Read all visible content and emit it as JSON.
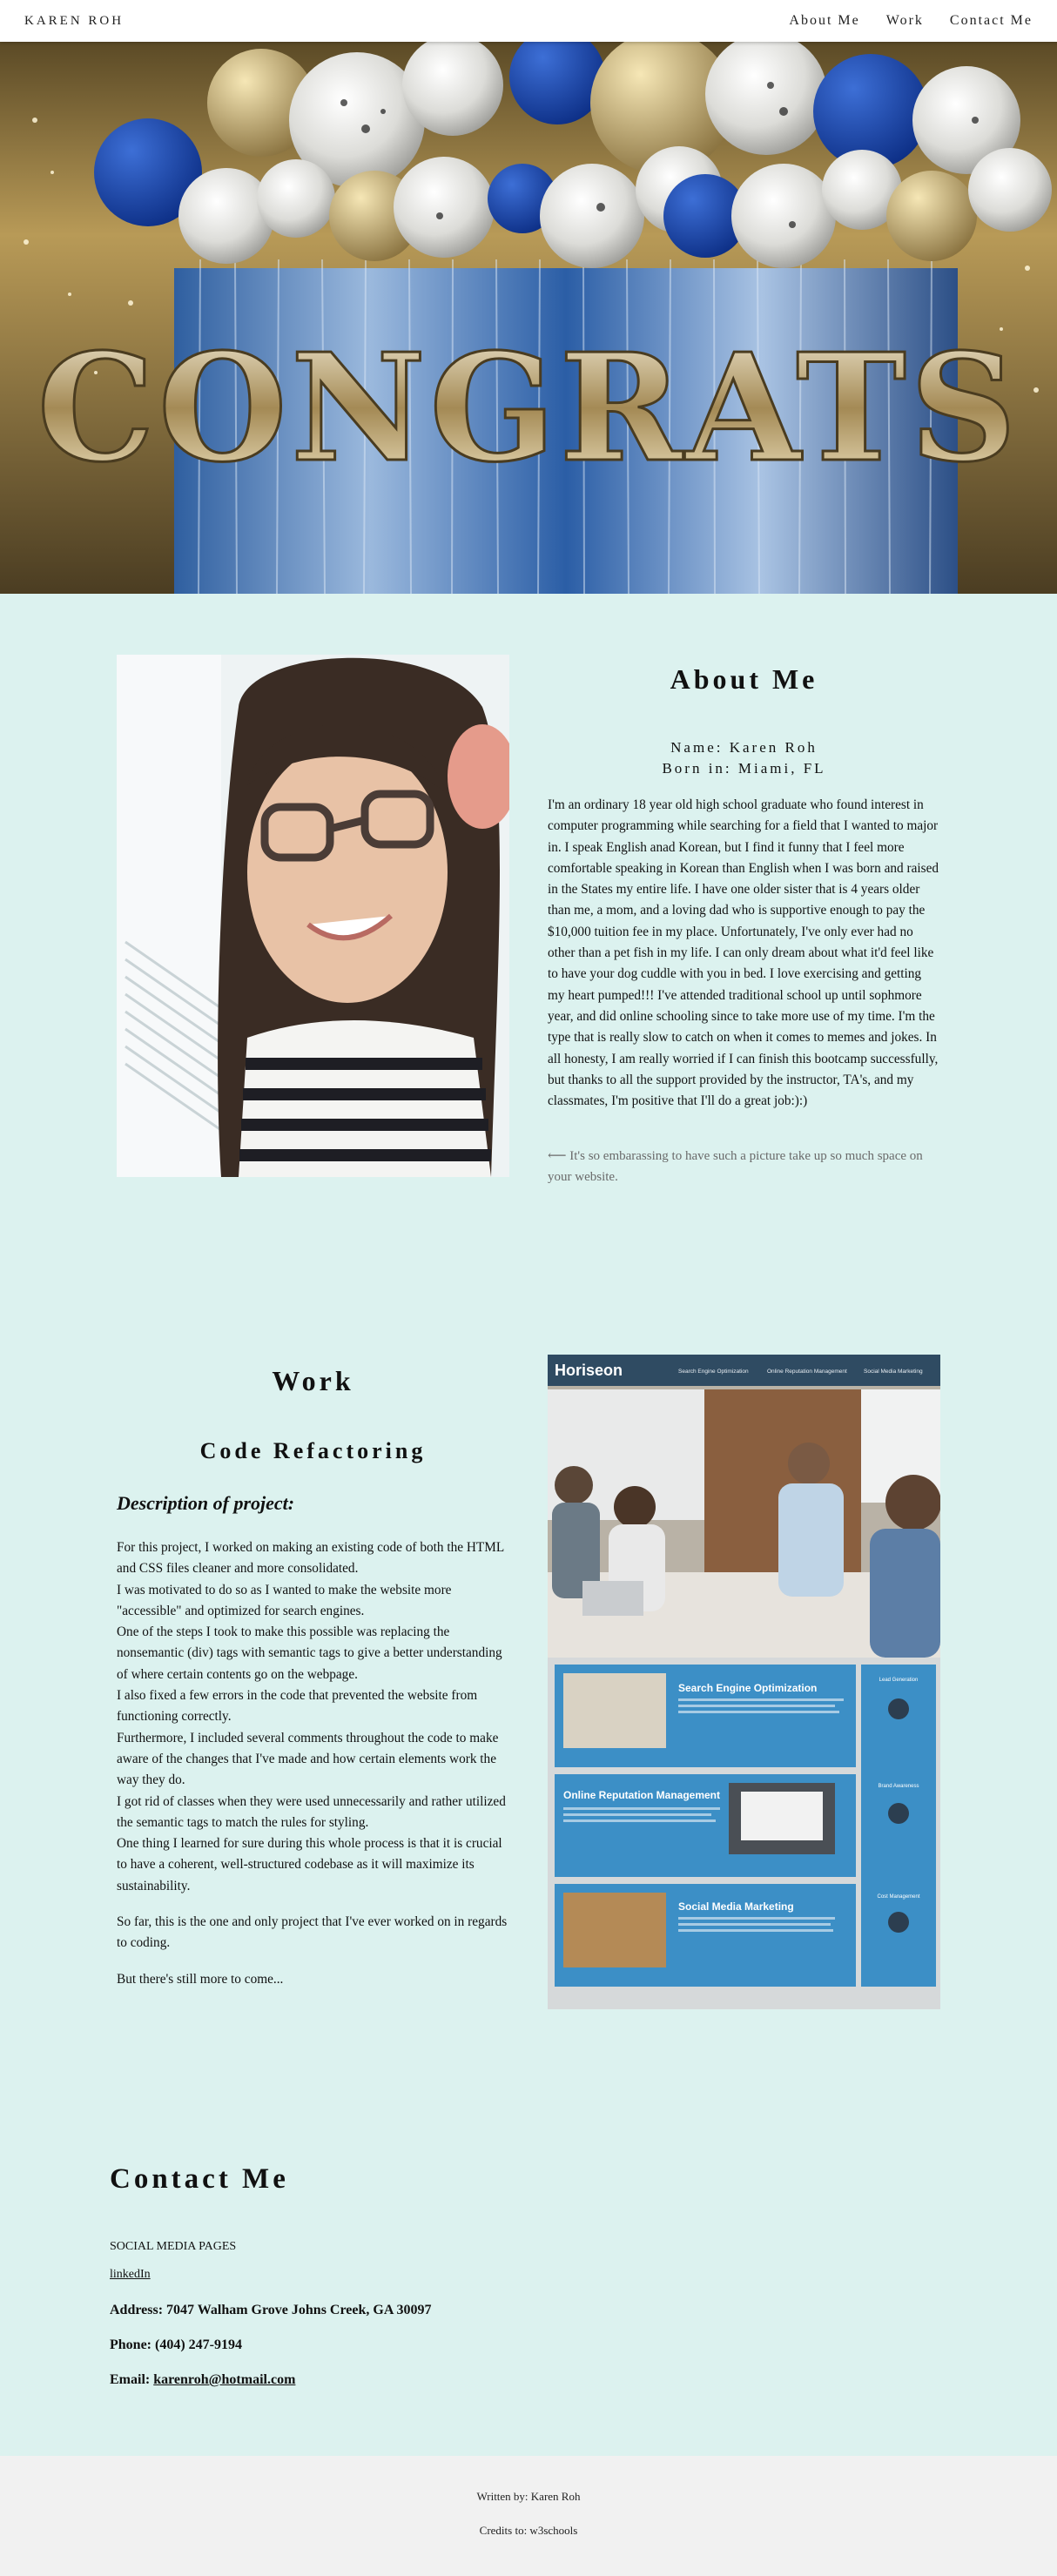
{
  "nav": {
    "brand": "KAREN ROH",
    "links": [
      "About Me",
      "Work",
      "Contact Me"
    ]
  },
  "hero": {
    "balloon_text": "CONGRATS"
  },
  "about": {
    "title": "About Me",
    "name_line": "Name: Karen Roh",
    "born_line": "Born in: Miami, FL",
    "body": "I'm an ordinary 18 year old high school graduate who found interest in computer programming while searching for a field that I wanted to major in. I speak English anad Korean, but I find it funny that I feel more comfortable speaking in Korean than English when I was born and raised in the States my entire life. I have one older sister that is 4 years older than me, a mom, and a loving dad who is supportive enough to pay the $10,000 tuition fee in my place. Unfortunately, I've only ever had no other than a pet fish in my life. I can only dream about what it'd feel like to have your dog cuddle with you in bed. I love exercising and getting my heart pumped!!! I've attended traditional school up until sophmore year, and did online schooling since to take more use of my time. I'm the type that is really slow to catch on when it comes to memes and jokes. In all honesty, I am really worried if I can finish this bootcamp successfully, but thanks to all the support provided by the instructor, TA's, and my classmates, I'm positive that I'll do a great job:):)",
    "note": "⟵ It's so embarassing to have such a picture take up so much space on your website."
  },
  "work": {
    "title": "Work",
    "subtitle": "Code Refactoring",
    "desc_heading": "Description of project:",
    "paragraph1_lines": [
      "For this project, I worked on making an existing code of both the HTML and CSS files cleaner and more consolidated.",
      "I was motivated to do so as I wanted to make the website more \"accessible\" and optimized for search engines.",
      "One of the steps I took to make this possible was replacing the nonsemantic (div) tags with semantic tags to give a better understanding of where certain contents go on the webpage.",
      "I also fixed a few errors in the code that prevented the website from functioning correctly.",
      "Furthermore, I included several comments throughout the code to make aware of the changes that I've made and how certain elements work the way they do.",
      "I got rid of classes when they were used unnecessarily and rather utilized the semantic tags to match the rules for styling.",
      "One thing I learned for sure during this whole process is that it is crucial to have a coherent, well-structured codebase as it will maximize its sustainability."
    ],
    "paragraph2": "So far, this is the one and only project that I've ever worked on in regards to coding.",
    "paragraph3": "But there's still more to come...",
    "screenshot": {
      "logo": "Horiseon",
      "nav": [
        "Search Engine Optimization",
        "Online Reputation Management",
        "Social Media Marketing"
      ],
      "cards": [
        "Search Engine Optimization",
        "Online Reputation Management",
        "Social Media Marketing"
      ],
      "side": [
        "Lead Generation",
        "Brand Awareness",
        "Cost Management"
      ]
    }
  },
  "contact": {
    "title": "Contact Me",
    "social_label": "SOCIAL MEDIA PAGES",
    "linkedin": "linkedIn",
    "address": "Address: 7047 Walham Grove Johns Creek, GA 30097",
    "phone": "Phone: (404) 247-9194",
    "email_label": "Email: ",
    "email": "karenroh@hotmail.com"
  },
  "footer": {
    "written_by": "Written by: Karen Roh",
    "credits": "Credits to: w3schools"
  },
  "colors": {
    "page_bg": "#dcf2ef",
    "footer_bg": "#f1f1f1",
    "horiseon_header": "#2f4b62",
    "horiseon_card": "#3c8fc6"
  }
}
